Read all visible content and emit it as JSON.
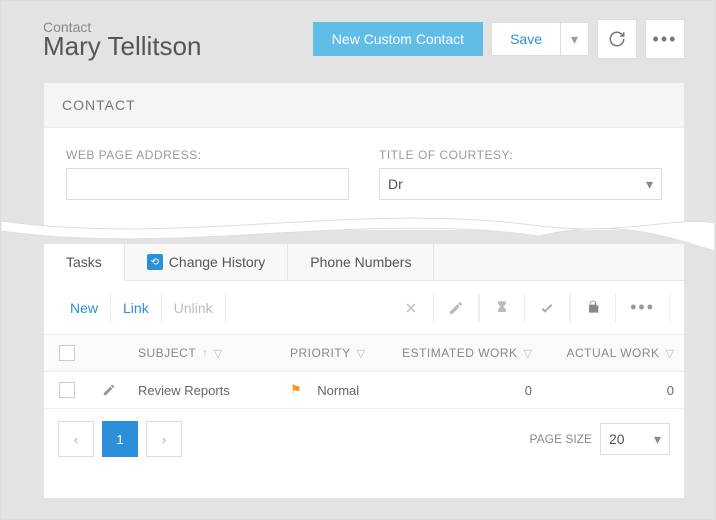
{
  "header": {
    "overline": "Contact",
    "title": "Mary Tellitson",
    "buttons": {
      "newCustom": "New Custom Contact",
      "save": "Save"
    }
  },
  "section": {
    "title": "CONTACT"
  },
  "form": {
    "webPage": {
      "label": "WEB PAGE ADDRESS:",
      "value": ""
    },
    "titleCourtesy": {
      "label": "TITLE OF COURTESY:",
      "value": "Dr"
    }
  },
  "tabs": [
    {
      "label": "Tasks"
    },
    {
      "label": "Change History"
    },
    {
      "label": "Phone Numbers"
    }
  ],
  "toolbar": {
    "new": "New",
    "link": "Link",
    "unlink": "Unlink"
  },
  "columns": {
    "subject": "SUBJECT",
    "priority": "PRIORITY",
    "estimated": "ESTIMATED WORK",
    "actual": "ACTUAL WORK"
  },
  "rows": [
    {
      "subject": "Review Reports",
      "priority": "Normal",
      "estimated": "0",
      "actual": "0"
    }
  ],
  "pager": {
    "current": "1",
    "sizeLabel": "PAGE SIZE",
    "size": "20"
  }
}
